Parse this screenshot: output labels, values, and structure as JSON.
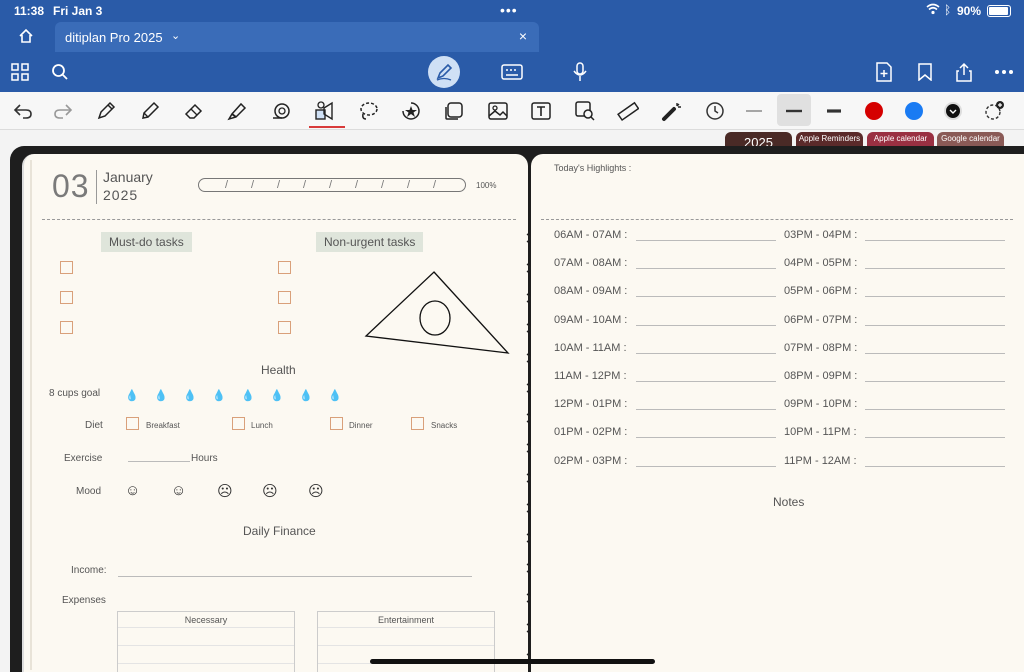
{
  "status_bar": {
    "time": "11:38",
    "date": "Fri Jan 3",
    "battery": "90%"
  },
  "tab": {
    "title": "ditiplan Pro 2025",
    "close": "×"
  },
  "action_bar": {
    "icons": [
      "grid-icon",
      "search-icon",
      "pen-icon",
      "keyboard-icon",
      "mic-icon",
      "add-page-icon",
      "bookmark-icon",
      "share-icon",
      "more-icon"
    ]
  },
  "tools": {
    "icons": [
      "undo-icon",
      "redo-icon",
      "pen-icon",
      "pencil-icon",
      "eraser-icon",
      "highlighter-icon",
      "tape-icon",
      "shapes-icon",
      "lasso-icon",
      "sticker-icon",
      "sticky-note-icon",
      "image-icon",
      "text-icon",
      "image-search-icon",
      "ruler-icon",
      "laser-pointer-icon",
      "clock-icon"
    ],
    "colors": [
      "#d50000",
      "#1a7bf3",
      "#111111"
    ]
  },
  "year_tabs": [
    {
      "label": "2025",
      "color": "#4a2a26"
    },
    {
      "label": "Apple Reminders",
      "color": "#5b2a2a"
    },
    {
      "label": "Apple calendar",
      "color": "#9a3042"
    },
    {
      "label": "Google calendar",
      "color": "#8a5a56"
    }
  ],
  "left_page": {
    "day": "03",
    "month": "January",
    "year": "2025",
    "progress": "100%",
    "progress_value": 1.0,
    "must_do": "Must-do tasks",
    "non_urgent": "Non-urgent tasks",
    "health": "Health",
    "water_label": "8 cups goal",
    "diet_label": "Diet",
    "diet_items": [
      "Breakfast",
      "Lunch",
      "Dinner",
      "Snacks"
    ],
    "exercise_label": "Exercise",
    "hours_label": "Hours",
    "mood_label": "Mood",
    "daily_finance": "Daily Finance",
    "income_label": "Income:",
    "expenses_label": "Expenses",
    "expense_cols": [
      "Necessary",
      "Entertainment"
    ]
  },
  "right_page": {
    "highlights": "Today's Highlights :",
    "slots_left": [
      "06AM - 07AM :",
      "07AM - 08AM :",
      "08AM - 09AM :",
      "09AM - 10AM :",
      "10AM - 11AM :",
      "11AM - 12PM :",
      "12PM - 01PM :",
      "01PM - 02PM :",
      "02PM - 03PM :"
    ],
    "slots_right": [
      "03PM - 04PM :",
      "04PM - 05PM :",
      "05PM - 06PM :",
      "06PM - 07PM :",
      "07PM - 08PM :",
      "08PM - 09PM :",
      "09PM - 10PM :",
      "10PM - 11PM :",
      "11PM - 12AM :"
    ],
    "notes": "Notes"
  }
}
